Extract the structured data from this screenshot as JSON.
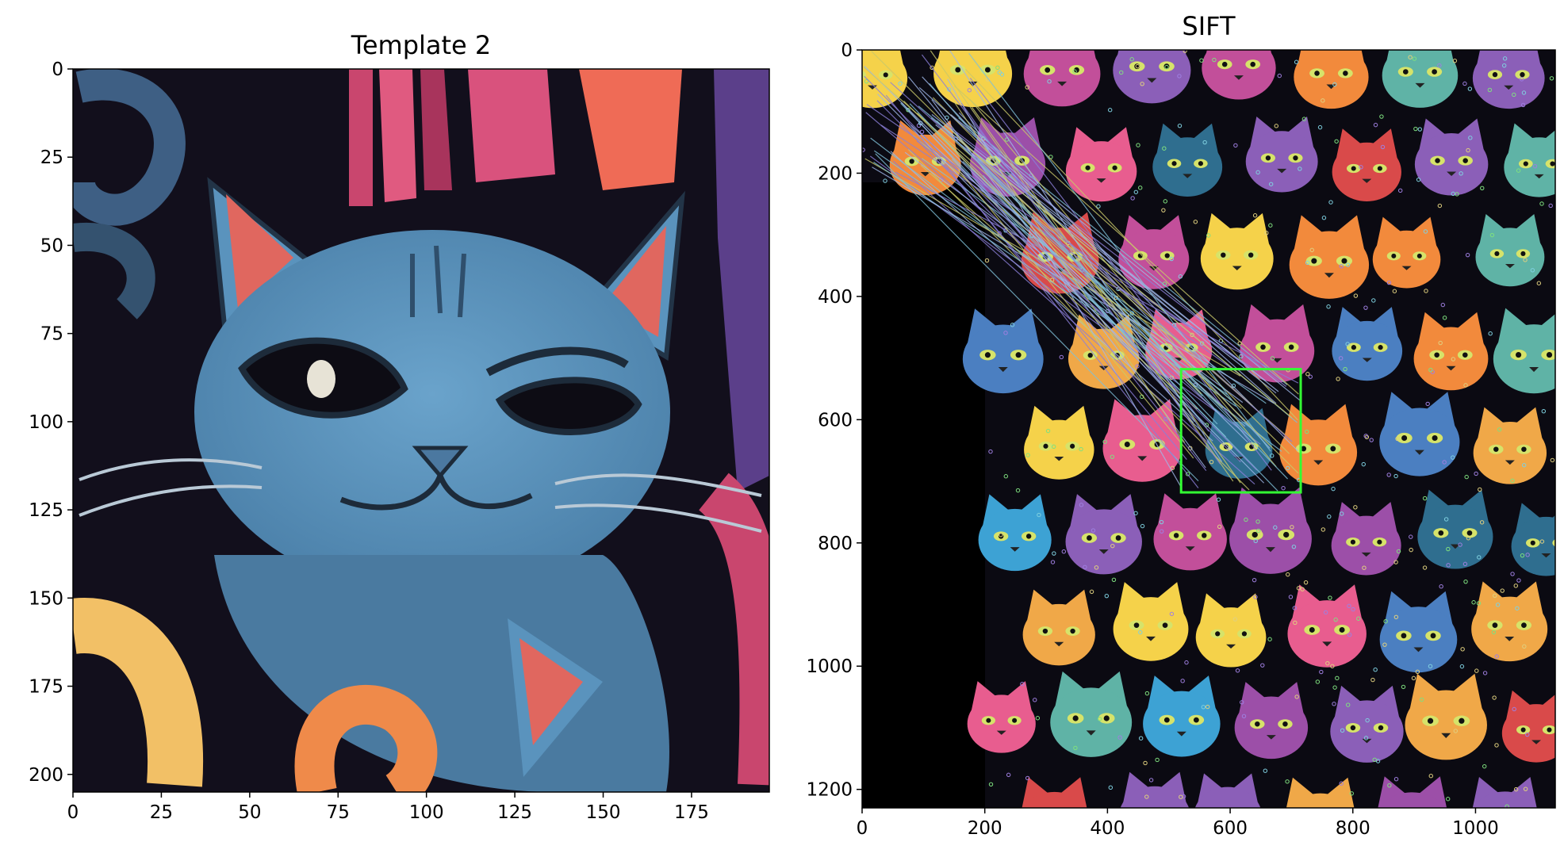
{
  "chart_data": [
    {
      "type": "image",
      "title": "Template 2",
      "xlim": [
        0,
        197
      ],
      "ylim": [
        205,
        0
      ],
      "x_ticks": [
        0,
        25,
        50,
        75,
        100,
        125,
        150,
        175
      ],
      "y_ticks": [
        0,
        25,
        50,
        75,
        100,
        125,
        150,
        175,
        200
      ],
      "image_content": "cropped template of a blue cat face on dark background with pink and orange swirls",
      "colors": {
        "cat": "#5a93bd",
        "ear_inner": "#e0675f",
        "background": "#120f1c",
        "pink": "#d9527d",
        "orange": "#ef8a4a",
        "yellow": "#f2c066"
      }
    },
    {
      "type": "image",
      "title": "SIFT",
      "xlim": [
        0,
        1130
      ],
      "ylim": [
        1230,
        0
      ],
      "x_ticks": [
        0,
        200,
        400,
        600,
        800,
        1000
      ],
      "y_ticks": [
        0,
        200,
        400,
        600,
        800,
        1000,
        1200
      ],
      "image_content": "SIFT keypoint matches from the template (left region) to a scene of many colorful cartoon cats",
      "match_box": {
        "x": [
          520,
          715
        ],
        "y": [
          518,
          718
        ],
        "color": "#33ff33"
      },
      "template_region_x_max": 197
    }
  ]
}
